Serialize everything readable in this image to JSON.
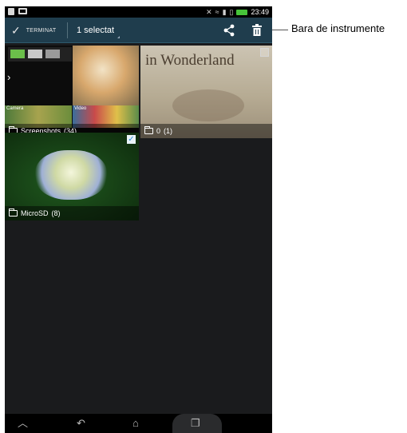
{
  "status_bar": {
    "time": "23:49",
    "icons": [
      "document-icon",
      "mail-icon",
      "mute-icon",
      "wifi-icon",
      "signal-icon",
      "no-sim-icon",
      "battery-icon"
    ]
  },
  "action_bar": {
    "done_label": "TERMINAT",
    "selection_label": "1 selectat",
    "actions": [
      "share-icon",
      "trash-icon"
    ]
  },
  "albums": [
    {
      "name": "Screenshots",
      "count": "(34)",
      "selected": false
    },
    {
      "name": "0",
      "count": "(1)",
      "selected": false
    },
    {
      "name": "MicroSD",
      "count": "(8)",
      "selected": true
    }
  ],
  "thumb_labels": {
    "camera": "Camera",
    "video": "Video",
    "wonder": "in Wonderland"
  },
  "nav_bar": {
    "buttons": [
      "back-icon",
      "home-icon",
      "recent-apps-icon",
      "up-icon"
    ]
  },
  "callout": {
    "label": "Bara de instrumente"
  },
  "colors": {
    "action_bar": "#1f3d4d",
    "background": "#1a1b1d",
    "check_accent": "#2b8fd6"
  }
}
